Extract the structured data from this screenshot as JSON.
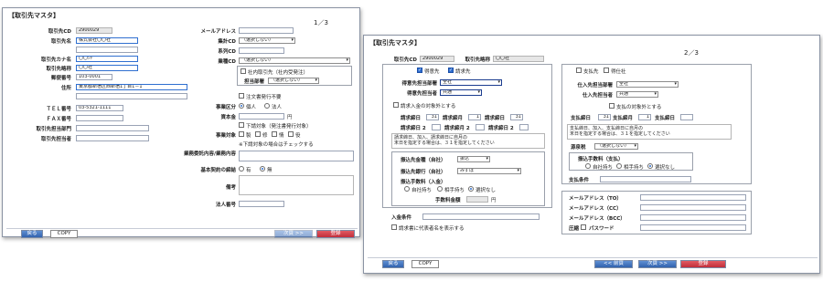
{
  "win1": {
    "title": "【取引先マスタ】",
    "page": "1／3",
    "fields": {
      "cd_label": "取引先CD",
      "cd_value": "2900029",
      "name_label": "取引先名",
      "name_value": "株式会社〇〇社",
      "kana_label": "取引先カナ名",
      "kana_value": "〇〇ｼｬ",
      "short_label": "取引先略称",
      "short_value": "〇〇社",
      "zip_label": "郵便番号",
      "zip_value": "103-0001",
      "addr_label": "住所",
      "addr_value": "東京都新宿区西新宿1丁目1－1",
      "tel_label": "ＴＥＬ番号",
      "tel_value": "03-5321-1111",
      "fax_label": "ＦＡＸ番号",
      "dept_label": "取引先担当部門",
      "person_label": "取引先担当者"
    },
    "right": {
      "mail_label": "メールアドレス",
      "group_label": "集計CD",
      "group_value": "（選択しない）",
      "keiretsu_label": "系列CD",
      "industry_label": "業種CD",
      "industry_value": "（選択しない）",
      "internal_label": "社内取引先（社内受発注）",
      "charge_dept_label": "担当部署",
      "charge_dept_value": "（選択しない）",
      "no_order_label": "注文書発行不要",
      "biz_type_label": "事業区分",
      "biz_individual": "個人",
      "biz_corp": "法人",
      "capital_label": "資本金",
      "capital_unit": "円",
      "subcon_label": "下請対象（発注書発行対象）",
      "sub_target_label": "事業対象",
      "sub_opts": [
        "製",
        "修",
        "情",
        "役"
      ],
      "sub_note": "※下請対象の場合はチェックする",
      "biz_content_label": "業務委託内容/業務内容",
      "basic_contract_label": "基本契約の締結",
      "contract_yes": "有",
      "contract_no": "無",
      "remarks_label": "備考",
      "corp_no_label": "法人番号"
    },
    "buttons": {
      "back": "戻る",
      "copy": "COPY",
      "next": "次頁 >>",
      "register": "登録"
    }
  },
  "win2": {
    "title": "【取引先マスタ】",
    "page": "2／3",
    "cd_label": "取引先CD",
    "cd_value": "2900029",
    "short_label": "取引先略称",
    "short_value": "〇〇社",
    "left": {
      "order_to": "得意先",
      "billing_to": "請求先",
      "order_dept_label": "得意先担当部署",
      "order_dept_value": "全社",
      "order_person_label": "得意先担当者",
      "order_person_value": "共通",
      "bill_all_label": "請求入金の対象外とする",
      "close1_label": "請求締日",
      "close1_value": "31",
      "due1_label": "請求締月",
      "due1_value": "1",
      "pay1_label": "請求締日",
      "pay1_value": "31",
      "close2_label": "請求締日 2",
      "due2_label": "請求締月 2",
      "pay2_label": "請求締日 2",
      "note_line1": "請求締日、加入、請求締日に自月の",
      "note_line2": "末日を指定する場合は、３１を指定してください",
      "method_label": "振込先金種（自社）",
      "method_value": "振込",
      "bank_label": "振込先銀行（自社）",
      "bank_value": "みずほ",
      "fee_label": "振込手数料（入金）",
      "fee_self": "自社持ち",
      "fee_other": "相手持ち",
      "fee_none": "選択なし",
      "fee_amount_label": "手数料金額",
      "fee_unit": "円",
      "deposit_label": "入金条件",
      "rep_label": "請求書に代表者名を表示する"
    },
    "right": {
      "pay_to": "支払先",
      "vendor": "得仕社",
      "buy_dept_label": "仕入先担当部署",
      "buy_dept_value": "全社",
      "buy_person_label": "仕入先担当者",
      "buy_person_value": "共通",
      "pay_all_label": "支払の対象外とする",
      "pclose_label": "支払締日",
      "pclose_value": "31",
      "pdue_label": "支払締月",
      "pdue_value": "1",
      "ppay_label": "支払締日",
      "pnote_line1": "支払締日、加入、支払締日に自月の",
      "pnote_line2": "末日を指定する場合は、３１を指定してください",
      "src_label": "源泉税",
      "src_value": "（選択しない）",
      "pfee_label": "振込手数料（支払）",
      "pfee_self": "自社持ち",
      "pfee_other": "相手持ち",
      "pfee_none": "選択なし",
      "pcond_label": "支払条件",
      "mail_to": "メールアドレス（TO）",
      "mail_cc": "メールアドレス（CC）",
      "mail_bcc": "メールアドレス（BCC）",
      "zip_pw_label": "圧縮",
      "password_label": "パスワード"
    },
    "buttons": {
      "back": "戻る",
      "copy": "COPY",
      "prev": "<< 前頁",
      "next": "次頁 >>",
      "register": "登録"
    }
  }
}
